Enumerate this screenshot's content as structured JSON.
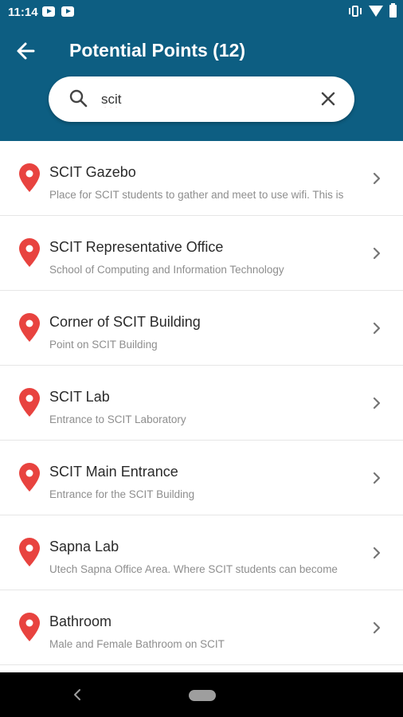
{
  "status_bar": {
    "time": "11:14",
    "left_icons": [
      "youtube-icon",
      "youtube-icon"
    ],
    "right_icons": [
      "vibrate-icon",
      "wifi-icon",
      "battery-icon"
    ]
  },
  "header": {
    "title": "Potential Points (12)",
    "back_icon": "arrow-left-icon",
    "background_color": "#0d5e82"
  },
  "search": {
    "value": "scit",
    "search_icon": "search-icon",
    "clear_icon": "close-icon"
  },
  "points": [
    {
      "title": "SCIT Gazebo",
      "description": "Place for SCIT students to gather and meet to use wifi. This is"
    },
    {
      "title": "SCIT Representative Office",
      "description": "School of Computing and Information Technology"
    },
    {
      "title": "Corner of SCIT Building",
      "description": "Point on SCIT Building"
    },
    {
      "title": "SCIT Lab",
      "description": "Entrance to SCIT Laboratory"
    },
    {
      "title": "SCIT Main Entrance",
      "description": "Entrance for the SCIT Building"
    },
    {
      "title": "Sapna Lab",
      "description": "Utech Sapna Office Area. Where SCIT students can become"
    },
    {
      "title": "Bathroom",
      "description": "Male and Female Bathroom on SCIT"
    }
  ],
  "pin_color": "#e8433f",
  "nav_bar": {
    "back_icon": "nav-back-icon",
    "home_icon": "nav-home-pill"
  }
}
